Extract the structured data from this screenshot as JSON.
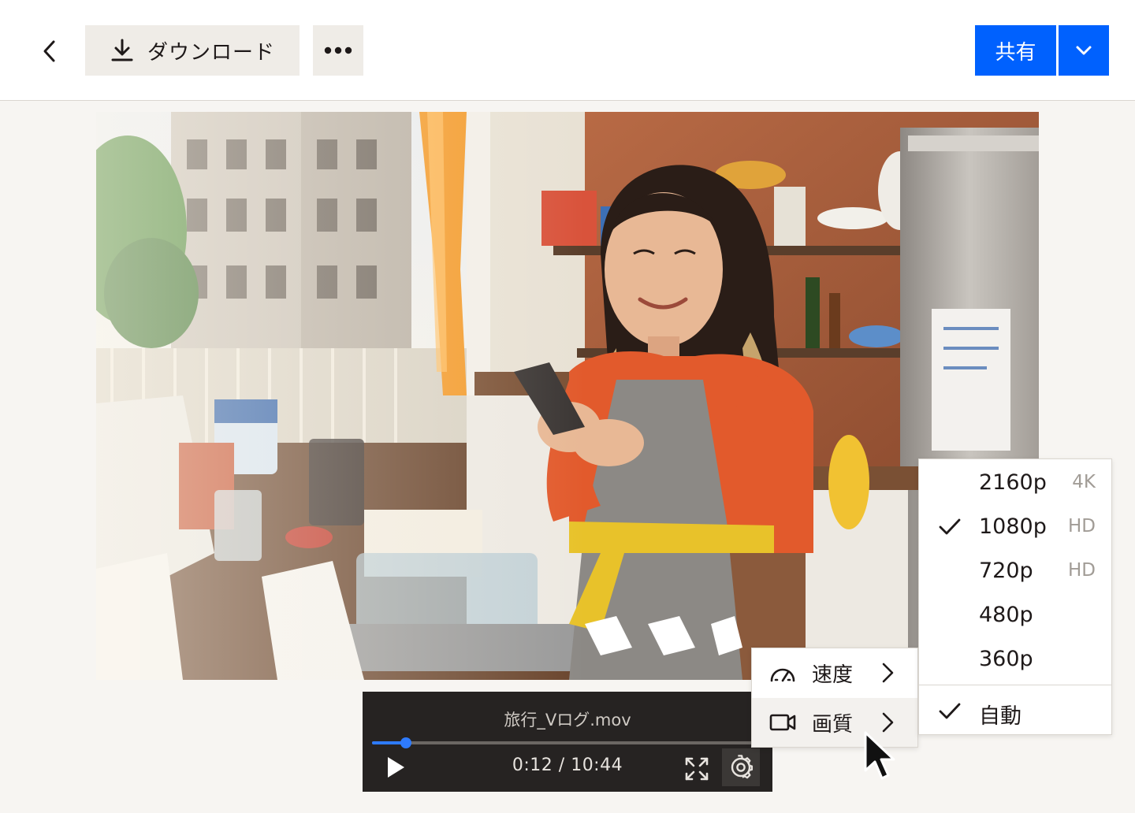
{
  "toolbar": {
    "back_icon": "chevron-left-icon",
    "download_label": "ダウンロード",
    "download_icon": "download-icon",
    "more_icon": "more-dots-icon",
    "share_label": "共有",
    "share_menu_icon": "chevron-down-icon"
  },
  "player": {
    "filename": "旅行_Vログ.mov",
    "time": "0:12 / 10:44",
    "progress_fraction": 0.0859,
    "play_icon": "play-icon",
    "fullscreen_icon": "fullscreen-icon",
    "settings_icon": "gear-icon"
  },
  "settings_menu": {
    "items": [
      {
        "label": "速度",
        "icon": "speedometer-icon"
      },
      {
        "label": "画質",
        "icon": "video-camera-icon"
      }
    ],
    "active_index": 1
  },
  "quality_menu": {
    "options": [
      {
        "label": "2160p",
        "tag": "4K",
        "selected": false
      },
      {
        "label": "1080p",
        "tag": "HD",
        "selected": true
      },
      {
        "label": "720p",
        "tag": "HD",
        "selected": false
      },
      {
        "label": "480p",
        "tag": "",
        "selected": false
      },
      {
        "label": "360p",
        "tag": "",
        "selected": false
      }
    ],
    "auto": {
      "label": "自動",
      "selected": true
    }
  },
  "colors": {
    "accent": "#0061fe",
    "progress": "#2e7bff",
    "player_bg": "#262322",
    "page_bg": "#f7f5f2"
  }
}
